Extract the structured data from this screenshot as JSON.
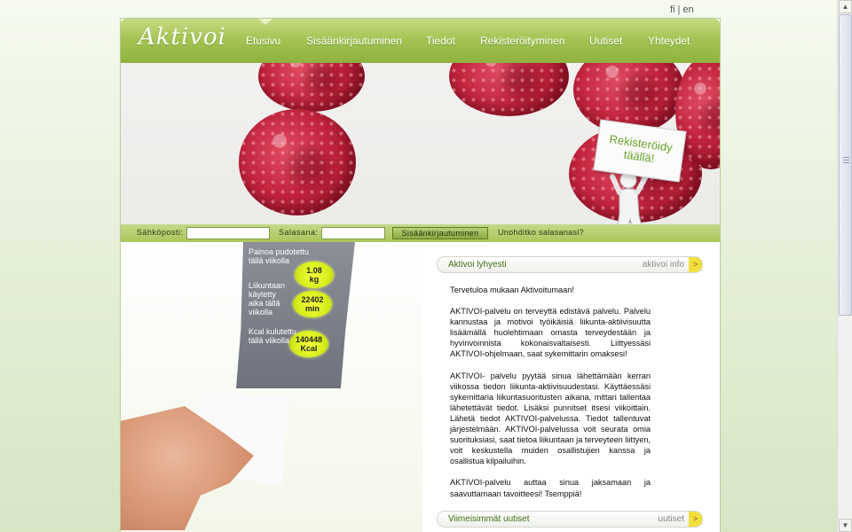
{
  "language": {
    "fi": "fi",
    "separator": "|",
    "en": "en"
  },
  "logo": "Aktivoi",
  "nav": [
    {
      "label": "Etusivu"
    },
    {
      "label": "Sisäänkirjautuminen"
    },
    {
      "label": "Tiedot"
    },
    {
      "label": "Rekisteröityminen"
    },
    {
      "label": "Uutiset"
    },
    {
      "label": "Yhteydet"
    }
  ],
  "hero": {
    "sign_line1": "Rekisteröidy",
    "sign_line2": "täällä!"
  },
  "login": {
    "email_label": "Sähköposti:",
    "password_label": "Salasana:",
    "submit_label": "Sisäänkirjautuminen",
    "forgot_label": "Unohditko salasanasi?",
    "email_value": "",
    "password_value": ""
  },
  "stats": [
    {
      "label": "Painoa pudotettu tällä viikolla",
      "value": "1.08",
      "unit": "kg"
    },
    {
      "label": "Liikuntaan käytetty aika tällä viikolla",
      "value": "22402",
      "unit": "min"
    },
    {
      "label": "Kcal kulutettu tällä viikolla",
      "value": "140448",
      "unit": "Kcal"
    }
  ],
  "info_box": {
    "title": "Aktivoi lyhyesti",
    "link": "aktivoi info",
    "arrow": ">",
    "paragraphs": [
      "Tervetuloa mukaan Aktivoitumaan!",
      "AKTIVOI-palvelu on terveyttä edistävä palvelu. Palvelu kannustaa ja motivoi työikäisiä liikunta-aktiivisuutta lisäämällä huolehtimaan omasta terveydestään ja hyvinvoinnista kokonaisvaltaisesti. Liittyessäsi AKTIVOI-ohjelmaan, saat sykemittarin omaksesi!",
      "AKTIVOI- palvelu pyytää sinua lähettämään kerran viikossa tiedon liikunta-aktiivisuudestasi. Käyttäessäsi sykemittaria liikuntasuoritusten aikana, mittari tallentaa lähetettävät tiedot. Lisäksi punnitset itsesi viikoittain. Lähetä tiedot AKTIVOI-palvelussa. Tiedot tallentuvat järjestelmään. AKTIVOI-palvelussa voit seurata omia suorituksiasi, saat tietoa liikuntaan ja terveyteen liittyen, voit keskustella muiden osallistujien kanssa ja osallistua kilpailuihin.",
      "AKTIVOI-palvelu auttaa sinua jaksamaan ja saavuttamaan tavoitteesi! Tsemppiä!"
    ]
  },
  "news_box": {
    "title": "Viimeisimmät uutiset",
    "link": "uutiset",
    "arrow": ">"
  },
  "colors": {
    "brand_green": "#9dbd4c",
    "accent_yellow": "#f2df3d",
    "berry_red": "#c2243d"
  }
}
